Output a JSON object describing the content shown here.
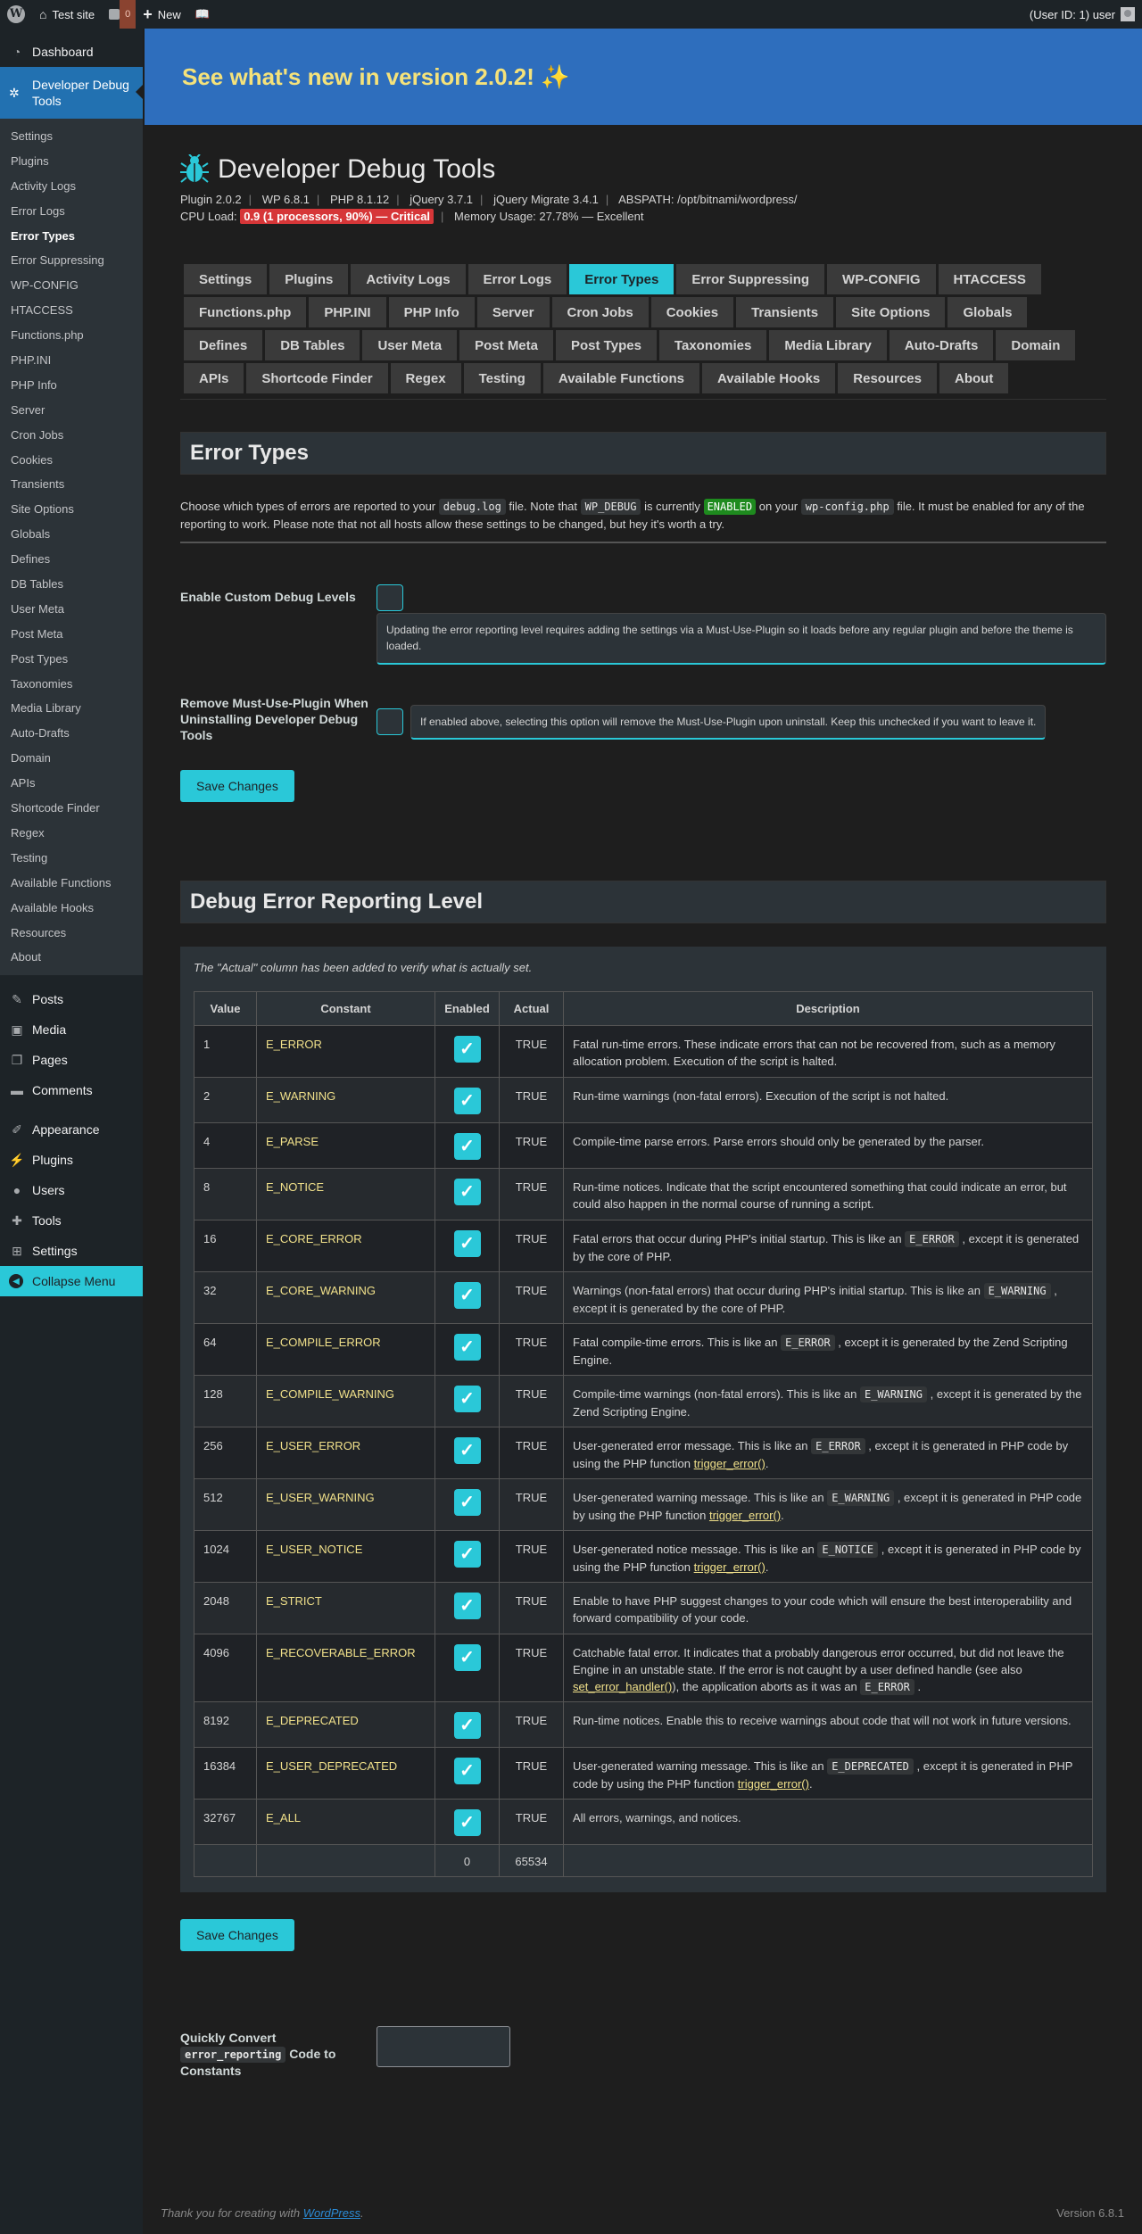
{
  "adminbar": {
    "site": "Test site",
    "comments_count": "0",
    "new_label": "New",
    "user": "(User ID: 1) user"
  },
  "sidebar": {
    "dashboard": "Dashboard",
    "current": "Developer Debug Tools",
    "submenu": [
      "Settings",
      "Plugins",
      "Activity Logs",
      "Error Logs",
      "Error Types",
      "Error Suppressing",
      "WP-CONFIG",
      "HTACCESS",
      "Functions.php",
      "PHP.INI",
      "PHP Info",
      "Server",
      "Cron Jobs",
      "Cookies",
      "Transients",
      "Site Options",
      "Globals",
      "Defines",
      "DB Tables",
      "User Meta",
      "Post Meta",
      "Post Types",
      "Taxonomies",
      "Media Library",
      "Auto-Drafts",
      "Domain",
      "APIs",
      "Shortcode Finder",
      "Regex",
      "Testing",
      "Available Functions",
      "Available Hooks",
      "Resources",
      "About"
    ],
    "posts": "Posts",
    "media": "Media",
    "pages": "Pages",
    "comments": "Comments",
    "appearance": "Appearance",
    "plugins": "Plugins",
    "users": "Users",
    "tools": "Tools",
    "settings": "Settings",
    "collapse": "Collapse Menu"
  },
  "banner": {
    "text": "See what's new in version 2.0.2! ✨"
  },
  "header": {
    "title": "Developer Debug Tools",
    "plugin": "Plugin 2.0.2",
    "wp": "WP 6.8.1",
    "php": "PHP 8.1.12",
    "jquery": "jQuery 3.7.1",
    "migrate": "jQuery Migrate 3.4.1",
    "abspath": "ABSPATH: /opt/bitnami/wordpress/",
    "cpu_label": "CPU Load:",
    "cpu_value": "0.9 (1 processors, 90%) — Critical",
    "memory": "Memory Usage: 27.78% — Excellent"
  },
  "tabs": [
    "Settings",
    "Plugins",
    "Activity Logs",
    "Error Logs",
    "Error Types",
    "Error Suppressing",
    "WP-CONFIG",
    "HTACCESS",
    "Functions.php",
    "PHP.INI",
    "PHP Info",
    "Server",
    "Cron Jobs",
    "Cookies",
    "Transients",
    "Site Options",
    "Globals",
    "Defines",
    "DB Tables",
    "User Meta",
    "Post Meta",
    "Post Types",
    "Taxonomies",
    "Media Library",
    "Auto-Drafts",
    "Domain",
    "APIs",
    "Shortcode Finder",
    "Regex",
    "Testing",
    "Available Functions",
    "Available Hooks",
    "Resources",
    "About"
  ],
  "active_tab": "Error Types",
  "error_types": {
    "heading": "Error Types",
    "desc_1": "Choose which types of errors are reported to your",
    "debug_log": "debug.log",
    "desc_2": "file. Note that",
    "wp_debug": "WP_DEBUG",
    "desc_3": "is currently",
    "enabled": "ENABLED",
    "desc_4": "on your",
    "wp_config": "wp-config.php",
    "desc_5": "file. It must be enabled for any of the reporting to work. Please note that not all hosts allow these settings to be changed, but hey it's worth a try.",
    "opt1_label": "Enable Custom Debug Levels",
    "opt1_notice": "Updating the error reporting level requires adding the settings via a Must-Use-Plugin so it loads before any regular plugin and before the theme is loaded.",
    "opt2_label": "Remove Must-Use-Plugin When Uninstalling Developer Debug Tools",
    "opt2_notice": "If enabled above, selecting this option will remove the Must-Use-Plugin upon uninstall. Keep this unchecked if you want to leave it.",
    "save": "Save Changes"
  },
  "reporting": {
    "heading": "Debug Error Reporting Level",
    "note": "The \"Actual\" column has been added to verify what is actually set.",
    "columns": [
      "Value",
      "Constant",
      "Enabled",
      "Actual",
      "Description"
    ],
    "rows": [
      {
        "value": "1",
        "constant": "E_ERROR",
        "enabled": true,
        "actual": "TRUE",
        "desc": [
          {
            "t": "Fatal run-time errors. These indicate errors that can not be recovered from, such as a memory allocation problem. Execution of the script is halted."
          }
        ]
      },
      {
        "value": "2",
        "constant": "E_WARNING",
        "enabled": true,
        "actual": "TRUE",
        "desc": [
          {
            "t": "Run-time warnings (non-fatal errors). Execution of the script is not halted."
          }
        ]
      },
      {
        "value": "4",
        "constant": "E_PARSE",
        "enabled": true,
        "actual": "TRUE",
        "desc": [
          {
            "t": "Compile-time parse errors. Parse errors should only be generated by the parser."
          }
        ]
      },
      {
        "value": "8",
        "constant": "E_NOTICE",
        "enabled": true,
        "actual": "TRUE",
        "desc": [
          {
            "t": "Run-time notices. Indicate that the script encountered something that could indicate an error, but could also happen in the normal course of running a script."
          }
        ]
      },
      {
        "value": "16",
        "constant": "E_CORE_ERROR",
        "enabled": true,
        "actual": "TRUE",
        "desc": [
          {
            "t": "Fatal errors that occur during PHP's initial startup. This is like an "
          },
          {
            "c": "E_ERROR"
          },
          {
            "t": " , except it is generated by the core of PHP."
          }
        ]
      },
      {
        "value": "32",
        "constant": "E_CORE_WARNING",
        "enabled": true,
        "actual": "TRUE",
        "desc": [
          {
            "t": "Warnings (non-fatal errors) that occur during PHP's initial startup. This is like an "
          },
          {
            "c": "E_WARNING"
          },
          {
            "t": " , except it is generated by the core of PHP."
          }
        ]
      },
      {
        "value": "64",
        "constant": "E_COMPILE_ERROR",
        "enabled": true,
        "actual": "TRUE",
        "desc": [
          {
            "t": "Fatal compile-time errors. This is like an "
          },
          {
            "c": "E_ERROR"
          },
          {
            "t": " , except it is generated by the Zend Scripting Engine."
          }
        ]
      },
      {
        "value": "128",
        "constant": "E_COMPILE_WARNING",
        "enabled": true,
        "actual": "TRUE",
        "desc": [
          {
            "t": "Compile-time warnings (non-fatal errors). This is like an "
          },
          {
            "c": "E_WARNING"
          },
          {
            "t": " , except it is generated by the Zend Scripting Engine."
          }
        ]
      },
      {
        "value": "256",
        "constant": "E_USER_ERROR",
        "enabled": true,
        "actual": "TRUE",
        "desc": [
          {
            "t": "User-generated error message. This is like an "
          },
          {
            "c": "E_ERROR"
          },
          {
            "t": " , except it is generated in PHP code by using the PHP function "
          },
          {
            "a": "trigger_error()"
          },
          {
            "t": "."
          }
        ]
      },
      {
        "value": "512",
        "constant": "E_USER_WARNING",
        "enabled": true,
        "actual": "TRUE",
        "desc": [
          {
            "t": "User-generated warning message. This is like an "
          },
          {
            "c": "E_WARNING"
          },
          {
            "t": " , except it is generated in PHP code by using the PHP function "
          },
          {
            "a": "trigger_error()"
          },
          {
            "t": "."
          }
        ]
      },
      {
        "value": "1024",
        "constant": "E_USER_NOTICE",
        "enabled": true,
        "actual": "TRUE",
        "desc": [
          {
            "t": "User-generated notice message. This is like an "
          },
          {
            "c": "E_NOTICE"
          },
          {
            "t": " , except it is generated in PHP code by using the PHP function "
          },
          {
            "a": "trigger_error()"
          },
          {
            "t": "."
          }
        ]
      },
      {
        "value": "2048",
        "constant": "E_STRICT",
        "enabled": true,
        "actual": "TRUE",
        "desc": [
          {
            "t": "Enable to have PHP suggest changes to your code which will ensure the best interoperability and forward compatibility of your code."
          }
        ]
      },
      {
        "value": "4096",
        "constant": "E_RECOVERABLE_ERROR",
        "enabled": true,
        "actual": "TRUE",
        "desc": [
          {
            "t": "Catchable fatal error. It indicates that a probably dangerous error occurred, but did not leave the Engine in an unstable state. If the error is not caught by a user defined handle (see also "
          },
          {
            "a": "set_error_handler()"
          },
          {
            "t": "), the application aborts as it was an "
          },
          {
            "c": "E_ERROR"
          },
          {
            "t": " ."
          }
        ]
      },
      {
        "value": "8192",
        "constant": "E_DEPRECATED",
        "enabled": true,
        "actual": "TRUE",
        "desc": [
          {
            "t": "Run-time notices. Enable this to receive warnings about code that will not work in future versions."
          }
        ]
      },
      {
        "value": "16384",
        "constant": "E_USER_DEPRECATED",
        "enabled": true,
        "actual": "TRUE",
        "desc": [
          {
            "t": "User-generated warning message. This is like an "
          },
          {
            "c": "E_DEPRECATED"
          },
          {
            "t": " , except it is generated in PHP code by using the PHP function "
          },
          {
            "a": "trigger_error()"
          },
          {
            "t": "."
          }
        ]
      },
      {
        "value": "32767",
        "constant": "E_ALL",
        "enabled": true,
        "actual": "TRUE",
        "desc": [
          {
            "t": "All errors, warnings, and notices."
          }
        ]
      }
    ],
    "footer_enabled": "0",
    "footer_actual": "65534",
    "save": "Save Changes"
  },
  "convert": {
    "label_1": "Quickly Convert",
    "code": "error_reporting",
    "label_2": "Code to Constants"
  },
  "footer": {
    "thanks": "Thank you for creating with",
    "link": "WordPress",
    "period": ".",
    "version": "Version 6.8.1"
  },
  "colors": {
    "accent": "#2ac8d8",
    "wp_blue": "#2271b1",
    "banner": "#2e6ebd",
    "critical": "#d63638",
    "enabled_badge": "#1e8a1e"
  },
  "icons": {
    "check": "✓",
    "bug": "bug-icon"
  }
}
